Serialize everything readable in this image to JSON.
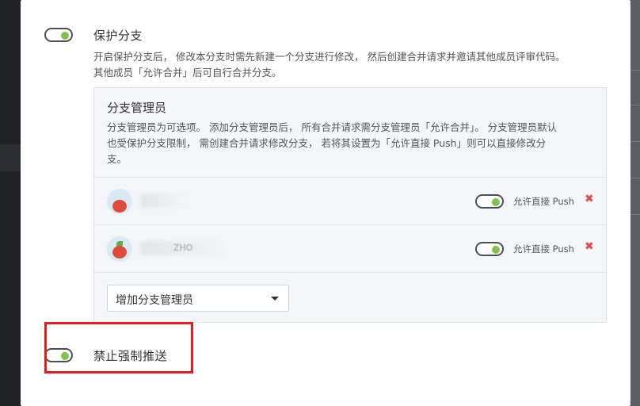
{
  "protect_branch": {
    "title": "保护分支",
    "enabled": true,
    "description_line1": "开启保护分支后， 修改本分支时需先新建一个分支进行修改， 然后创建合并请求并邀请其他成员评审代码。",
    "description_line2": "其他成员「允许合并」后可自行合并分支。"
  },
  "branch_admins": {
    "title": "分支管理员",
    "description_line1": "分支管理员为可选项。 添加分支管理员后， 所有合并请求需分支管理员「允许合并」。 分支管理员默认",
    "description_line2": "也受保护分支限制， 需创建合并请求修改分支， 若将其设置为「允许直接 Push」则可以直接修改分",
    "description_line3": "支。",
    "members": [
      {
        "name": "",
        "allow_push_label": "允许直接 Push",
        "allow_push": true,
        "remove_icon": "close-icon"
      },
      {
        "name": "ZHO",
        "allow_push_label": "允许直接 Push",
        "allow_push": true,
        "remove_icon": "close-icon"
      }
    ],
    "add_select": {
      "selected": "增加分支管理员"
    }
  },
  "force_push": {
    "title": "禁止强制推送",
    "enabled": true
  },
  "colors": {
    "toggle_on": "#7ec34a",
    "remove": "#e14b4b",
    "highlight": "#e01f1f"
  }
}
